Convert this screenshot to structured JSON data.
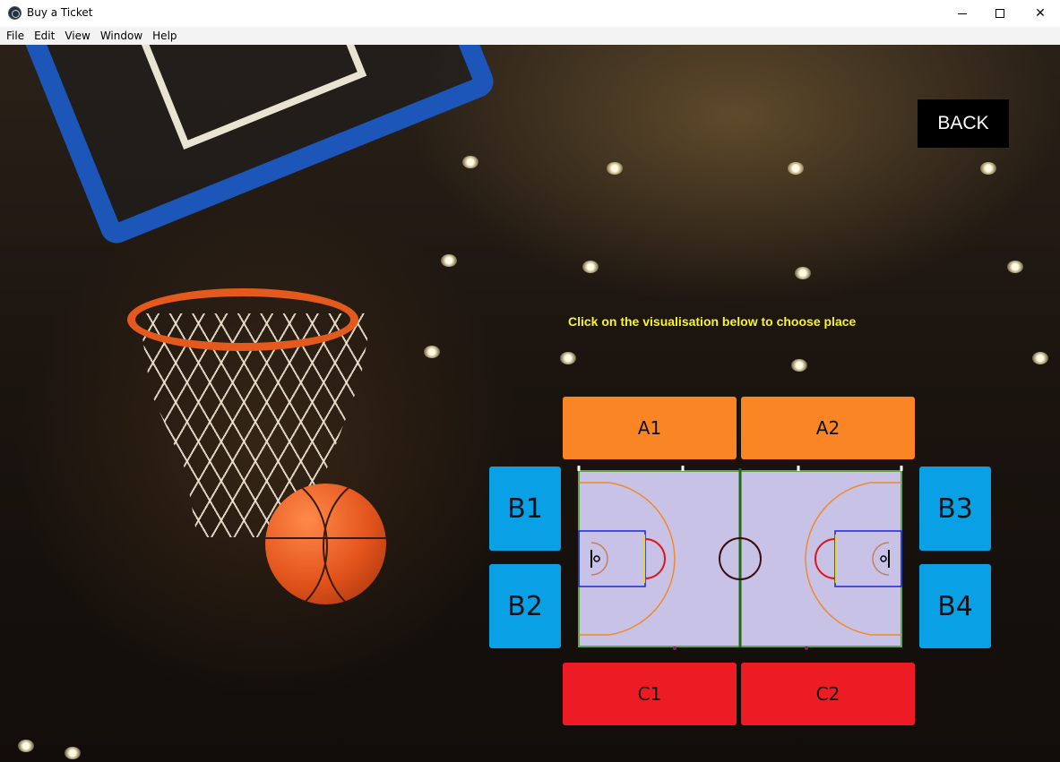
{
  "window": {
    "title": "Buy a Ticket",
    "minimize_glyph": "",
    "maximize_glyph": "",
    "close_glyph": "✕"
  },
  "menu": {
    "items": [
      "File",
      "Edit",
      "View",
      "Window",
      "Help"
    ]
  },
  "main": {
    "back_label": "BACK",
    "hint": "Click on the visualisation below to choose place"
  },
  "seats": {
    "a1": "A1",
    "a2": "A2",
    "b1": "B1",
    "b2": "B2",
    "b3": "B3",
    "b4": "B4",
    "c1": "C1",
    "c2": "C2"
  },
  "colors": {
    "section_a": "#f98524",
    "section_b": "#0aa0e6",
    "section_c": "#ed1c24",
    "court_floor": "#c8c2e6",
    "hint_text": "#f7f523",
    "back_button": "#000000"
  },
  "icons": {
    "app": "electron-app-icon",
    "minimize": "minimize-icon",
    "maximize": "maximize-icon",
    "close": "close-icon"
  }
}
